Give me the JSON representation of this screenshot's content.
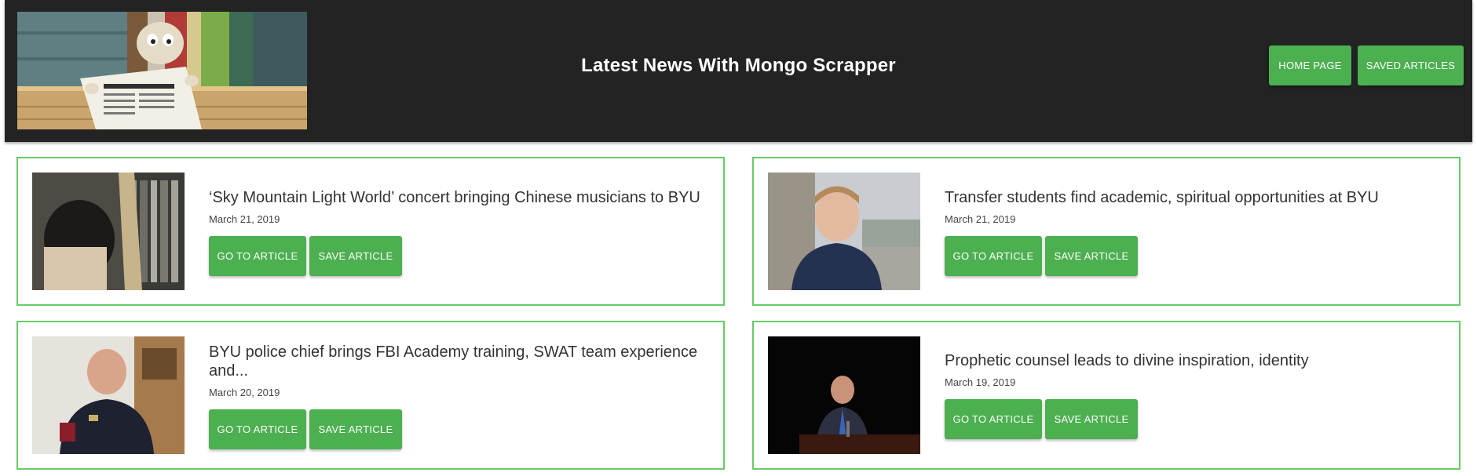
{
  "header": {
    "title": "Latest News With Mongo Scrapper",
    "logo_alt": "clay figure reading a newspaper",
    "nav": {
      "home_label": "HOME PAGE",
      "saved_label": "SAVED ARTICLES"
    }
  },
  "colors": {
    "header_bg": "#232323",
    "accent_green": "#4caf50",
    "card_border": "#66cc66"
  },
  "articles": [
    {
      "headline": "‘Sky Mountain Light World’ concert bringing Chinese musicians to BYU",
      "date": "March 21, 2019",
      "go_label": "GO TO ARTICLE",
      "save_label": "SAVE ARTICLE"
    },
    {
      "headline": "Transfer students find academic, spiritual opportunities at BYU",
      "date": "March 21, 2019",
      "go_label": "GO TO ARTICLE",
      "save_label": "SAVE ARTICLE"
    },
    {
      "headline": "BYU police chief brings FBI Academy training, SWAT team experience and...",
      "date": "March 20, 2019",
      "go_label": "GO TO ARTICLE",
      "save_label": "SAVE ARTICLE"
    },
    {
      "headline": "Prophetic counsel leads to divine inspiration, identity",
      "date": "March 19, 2019",
      "go_label": "GO TO ARTICLE",
      "save_label": "SAVE ARTICLE"
    }
  ]
}
